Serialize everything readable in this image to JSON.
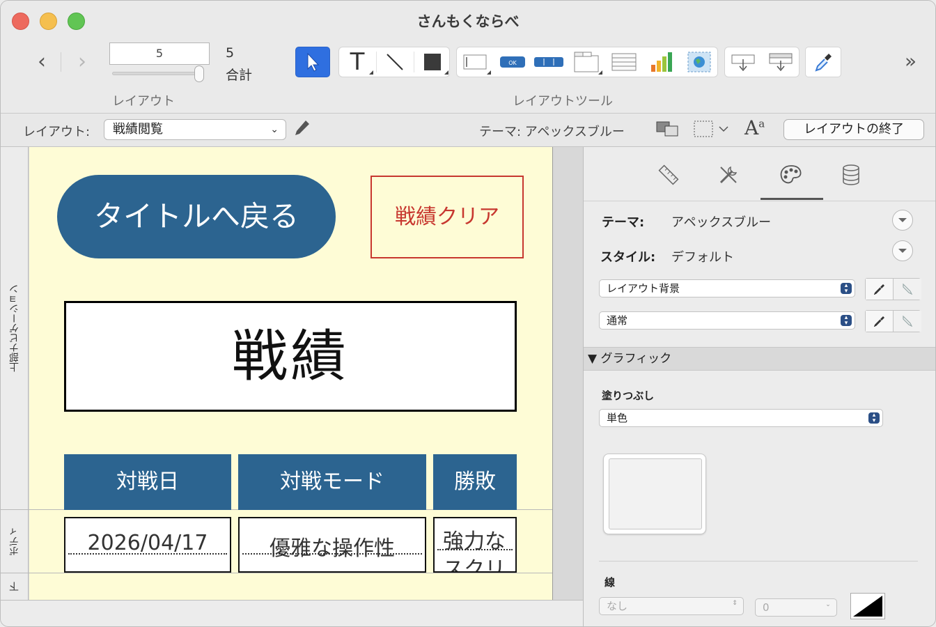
{
  "window": {
    "title": "さんもくならべ"
  },
  "toolbar": {
    "page_value": "5",
    "total_count": "5",
    "total_label": "合計",
    "layout_section_label": "レイアウト",
    "tools_section_label": "レイアウトツール",
    "text_tool_label": "T",
    "ok_button_label": "OK"
  },
  "layoutbar": {
    "layout_label": "レイアウト:",
    "layout_selected": "戦績閲覧",
    "theme_label": "テーマ: アペックスブルー",
    "exit_button": "レイアウトの終了"
  },
  "parts": {
    "header": "上部ナビゲーション",
    "body": "ボディ",
    "footer": "下"
  },
  "layout": {
    "back_button": "タイトルへ戻る",
    "clear_button": "戦績クリア",
    "page_title": "戦績",
    "columns": [
      "対戦日",
      "対戦モード",
      "勝敗"
    ],
    "row": [
      "2026/04/17",
      "優雅な操作性",
      "強力なスクリ"
    ]
  },
  "inspector": {
    "theme_label": "テーマ:",
    "theme_value": "アペックスブルー",
    "style_label": "スタイル:",
    "style_value": "デフォルト",
    "element_popup": "レイアウト背景",
    "state_popup": "通常",
    "graphic_section": "▼ グラフィック",
    "fill_label": "塗りつぶし",
    "fill_popup": "単色",
    "line_label": "線",
    "line_style_popup": "なし",
    "line_width_popup": "0"
  },
  "colors": {
    "accent": "#2c6490",
    "clear_red": "#c7372f",
    "layout_bg": "#fefcd6",
    "selected_tool": "#2f6fe0"
  }
}
